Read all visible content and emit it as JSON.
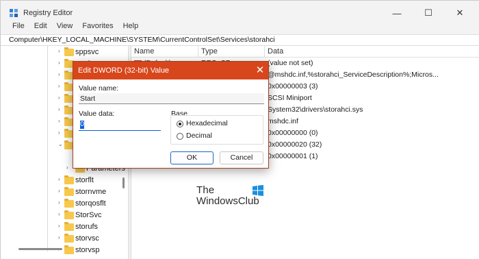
{
  "window": {
    "title": "Registry Editor",
    "minimize": "—",
    "maximize": "☐",
    "close": "✕"
  },
  "menu": [
    "File",
    "Edit",
    "View",
    "Favorites",
    "Help"
  ],
  "address": "Computer\\HKEY_LOCAL_MACHINE\\SYSTEM\\CurrentControlSet\\Services\\storahci",
  "tree": {
    "items": [
      {
        "label": "sppsvc",
        "chevron": "›"
      },
      {
        "label": "spy2",
        "chevron": "›"
      },
      {
        "label": "",
        "chevron": "›"
      },
      {
        "label": "",
        "chevron": "›"
      },
      {
        "label": "",
        "chevron": "›"
      },
      {
        "label": "",
        "chevron": "›"
      },
      {
        "label": "",
        "chevron": "›"
      },
      {
        "label": "",
        "chevron": "›"
      },
      {
        "label": "",
        "chevron": "⌄"
      },
      {
        "label": "",
        "chevron": ""
      },
      {
        "label": "Parameters",
        "chevron": "›"
      },
      {
        "label": "storflt",
        "chevron": "›"
      },
      {
        "label": "stornvme",
        "chevron": "›"
      },
      {
        "label": "storqosflt",
        "chevron": "›"
      },
      {
        "label": "StorSvc",
        "chevron": "›"
      },
      {
        "label": "storufs",
        "chevron": "›"
      },
      {
        "label": "storvsc",
        "chevron": "›"
      },
      {
        "label": "storvsp",
        "chevron": "›"
      }
    ]
  },
  "list": {
    "columns": [
      "Name",
      "Type",
      "Data"
    ],
    "default_name": "(Default)",
    "default_type": "REG_SZ",
    "data": [
      "(value not set)",
      "@mshdc.inf,%storahci_ServiceDescription%;Micros...",
      "0x00000003 (3)",
      "SCSI Miniport",
      "System32\\drivers\\storahci.sys",
      "mshdc.inf",
      "0x00000000 (0)",
      "0x00000020 (32)",
      "0x00000001 (1)"
    ]
  },
  "watermark": {
    "line1": "The",
    "line2": "WindowsClub"
  },
  "dialog": {
    "title": "Edit DWORD (32-bit) Value",
    "close": "✕",
    "value_name_label": "Value name:",
    "value_name": "Start",
    "value_data_label": "Value data:",
    "value_data": "0",
    "base_label": "Base",
    "radio_hex": "Hexadecimal",
    "radio_dec": "Decimal",
    "ok": "OK",
    "cancel": "Cancel"
  },
  "colors": {
    "dialog_title_bg": "#d8461c",
    "folder": "#f7c84b",
    "ok_border": "#1d62c9"
  }
}
